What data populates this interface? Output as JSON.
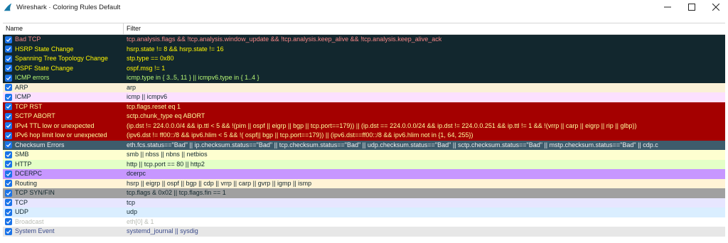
{
  "window": {
    "title": "Wireshark · Coloring Rules Default",
    "app_icon": "wireshark-fin-icon",
    "controls": [
      "minimize-icon",
      "maximize-icon",
      "close-icon"
    ]
  },
  "table": {
    "columns": {
      "name": "Name",
      "filter": "Filter"
    },
    "rows": [
      {
        "name": "Bad TCP",
        "filter": "tcp.analysis.flags && !tcp.analysis.window_update && !tcp.analysis.keep_alive && !tcp.analysis.keep_alive_ack",
        "bg": "#12272e",
        "fg": "#f78787",
        "checked": true
      },
      {
        "name": "HSRP State Change",
        "filter": "hsrp.state != 8 && hsrp.state != 16",
        "bg": "#12272e",
        "fg": "#fff600",
        "checked": true
      },
      {
        "name": "Spanning Tree Topology  Change",
        "filter": "stp.type == 0x80",
        "bg": "#12272e",
        "fg": "#fff600",
        "checked": true
      },
      {
        "name": "OSPF State Change",
        "filter": "ospf.msg != 1",
        "bg": "#12272e",
        "fg": "#fff600",
        "checked": true
      },
      {
        "name": "ICMP errors",
        "filter": "icmp.type in { 3..5, 11 } || icmpv6.type in { 1..4 }",
        "bg": "#12272e",
        "fg": "#b7f774",
        "checked": true
      },
      {
        "name": "ARP",
        "filter": "arp",
        "bg": "#faf0d7",
        "fg": "#12272e",
        "checked": true
      },
      {
        "name": "ICMP",
        "filter": "icmp || icmpv6",
        "bg": "#fce0ff",
        "fg": "#12272e",
        "checked": true
      },
      {
        "name": "TCP RST",
        "filter": "tcp.flags.reset eq 1",
        "bg": "#a40000",
        "fg": "#fffc9c",
        "checked": true
      },
      {
        "name": "SCTP ABORT",
        "filter": "sctp.chunk_type eq ABORT",
        "bg": "#a40000",
        "fg": "#fffc9c",
        "checked": true
      },
      {
        "name": "IPv4 TTL low or unexpected",
        "filter": "(ip.dst != 224.0.0.0/4 && ip.ttl < 5 && !(pim || ospf || eigrp || bgp || tcp.port==179)) || (ip.dst == 224.0.0.0/24 && ip.dst != 224.0.0.251 && ip.ttl != 1 && !(vrrp || carp || eigrp || rip || glbp))",
        "bg": "#a40000",
        "fg": "#fffc9c",
        "checked": true
      },
      {
        "name": "IPv6 hop limit low or unexpected",
        "filter": "(ipv6.dst != ff00::/8 && ipv6.hlim < 5 && !( ospf|| bgp || tcp.port==179)) || (ipv6.dst==ff00::/8 && ipv6.hlim not in {1, 64, 255})",
        "bg": "#a40000",
        "fg": "#fffc9c",
        "checked": true
      },
      {
        "name": "Checksum Errors",
        "filter": "eth.fcs.status==\"Bad\" || ip.checksum.status==\"Bad\" || tcp.checksum.status==\"Bad\" || udp.checksum.status==\"Bad\" || sctp.checksum.status==\"Bad\" || mstp.checksum.status==\"Bad\" || cdp.c",
        "bg": "#3e5c6c",
        "fg": "#f0f0f0",
        "checked": true
      },
      {
        "name": "SMB",
        "filter": "smb || nbss || nbns || netbios",
        "bg": "#feffd0",
        "fg": "#12272e",
        "checked": true
      },
      {
        "name": "HTTP",
        "filter": "http || tcp.port == 80 || http2",
        "bg": "#e4ffc7",
        "fg": "#12272e",
        "checked": true
      },
      {
        "name": "DCERPC",
        "filter": "dcerpc",
        "bg": "#c797ff",
        "fg": "#12272e",
        "checked": true
      },
      {
        "name": "Routing",
        "filter": "hsrp || eigrp || ospf || bgp || cdp || vrrp || carp || gvrp || igmp || ismp",
        "bg": "#fff3d6",
        "fg": "#12272e",
        "checked": true
      },
      {
        "name": "TCP SYN/FIN",
        "filter": "tcp.flags & 0x02 || tcp.flags.fin == 1",
        "bg": "#a0a0a0",
        "fg": "#12272e",
        "checked": true
      },
      {
        "name": "TCP",
        "filter": "tcp",
        "bg": "#e7e6ff",
        "fg": "#12272e",
        "checked": true
      },
      {
        "name": "UDP",
        "filter": "udp",
        "bg": "#daeeff",
        "fg": "#12272e",
        "checked": true
      },
      {
        "name": "Broadcast",
        "filter": "eth[0] & 1",
        "bg": "#ffffff",
        "fg": "#babdb6",
        "checked": true
      },
      {
        "name": "System Event",
        "filter": "systemd_journal || sysdig",
        "bg": "#e7e7e7",
        "fg": "#3a4a8a",
        "checked": true
      }
    ]
  }
}
